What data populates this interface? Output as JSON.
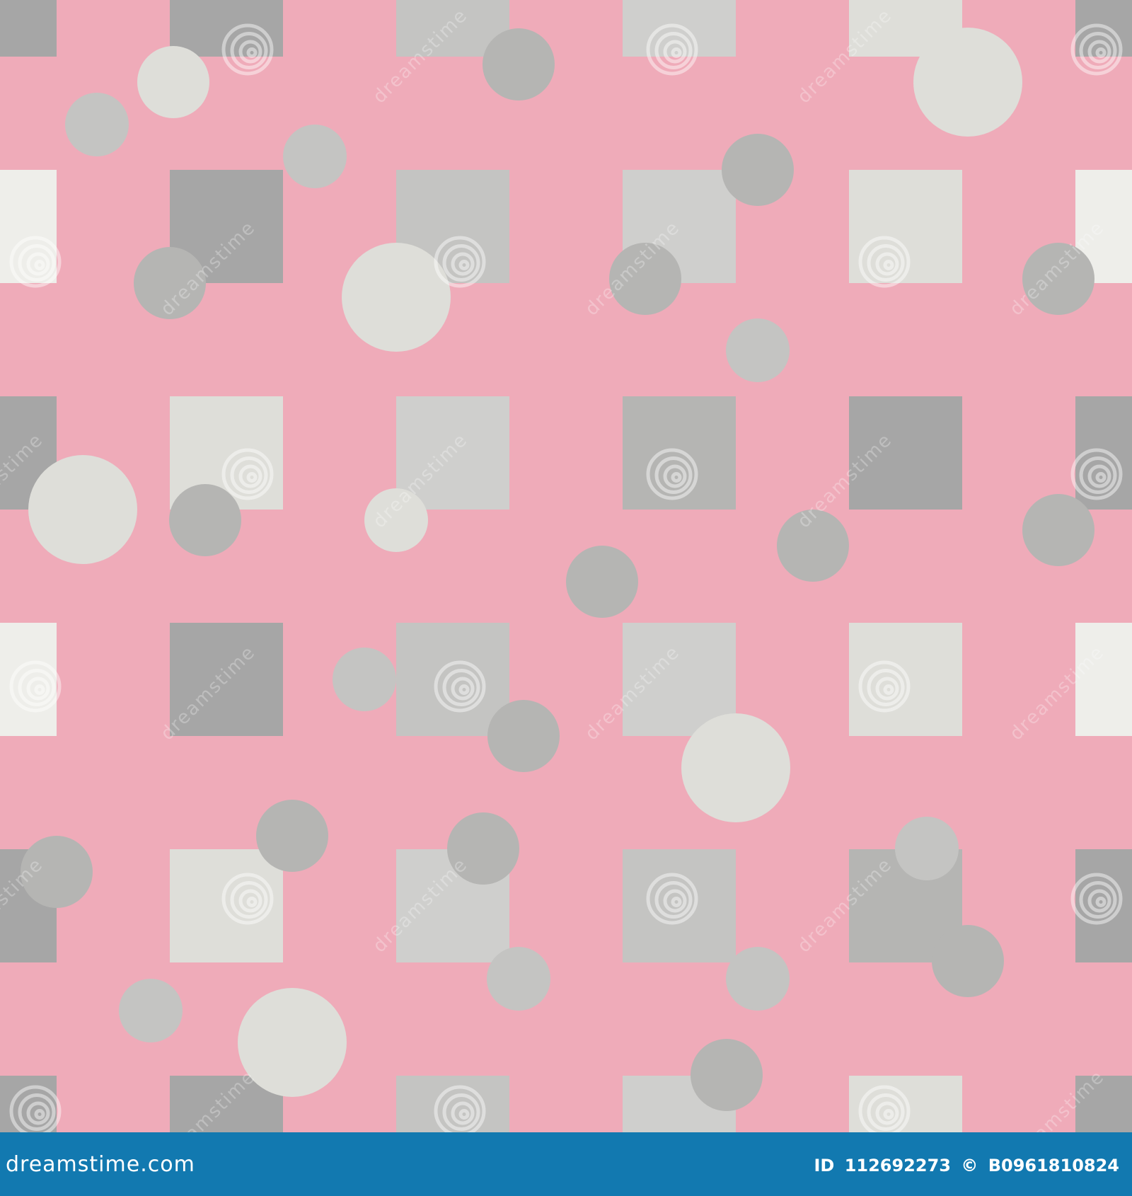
{
  "colors": {
    "background": "#efabb9",
    "footer": "#1279b0",
    "footer_text": "#ffffff",
    "shapes": [
      "#a6a6a6",
      "#b5b5b3",
      "#c4c4c2",
      "#cfcfcd",
      "#dedeD9",
      "#eeeeea"
    ]
  },
  "watermark": {
    "text": "dreamstime",
    "icon": "spiral-logo-icon"
  },
  "footer": {
    "brand": "dreamstime.com",
    "id_label": "ID",
    "id_value": "112692273",
    "copyright_symbol": "©",
    "author_code": "B0961810824"
  }
}
